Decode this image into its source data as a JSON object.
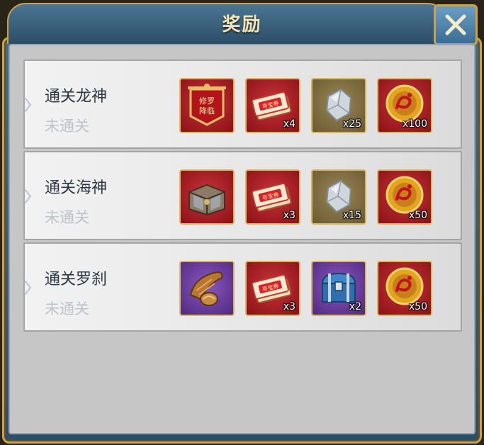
{
  "title": "奖励",
  "close": {
    "icon": "close-icon"
  },
  "rows": [
    {
      "title": "通关龙神",
      "status": "未通关",
      "rewards": [
        {
          "icon": "asura-banner-icon",
          "qty": "",
          "bg": "red"
        },
        {
          "icon": "treasure-ticket-icon",
          "qty": "x4",
          "bg": "red"
        },
        {
          "icon": "silver-ore-icon",
          "qty": "x25",
          "bg": "gold"
        },
        {
          "icon": "gold-coin-icon",
          "qty": "x100",
          "bg": "red"
        }
      ]
    },
    {
      "title": "通关海神",
      "status": "未通关",
      "rewards": [
        {
          "icon": "iron-chest-icon",
          "qty": "",
          "bg": "red"
        },
        {
          "icon": "treasure-ticket-icon",
          "qty": "x3",
          "bg": "red"
        },
        {
          "icon": "silver-ore-icon",
          "qty": "x15",
          "bg": "gold"
        },
        {
          "icon": "gold-coin-icon",
          "qty": "x50",
          "bg": "red"
        }
      ]
    },
    {
      "title": "通关罗刹",
      "status": "未通关",
      "rewards": [
        {
          "icon": "food-horn-icon",
          "qty": "",
          "bg": "purple"
        },
        {
          "icon": "treasure-ticket-icon",
          "qty": "x3",
          "bg": "red"
        },
        {
          "icon": "blue-chest-icon",
          "qty": "x2",
          "bg": "purple"
        },
        {
          "icon": "gold-coin-icon",
          "qty": "x50",
          "bg": "red"
        }
      ]
    }
  ],
  "ticket_text": "寻宝券",
  "banner_text": [
    "修罗",
    "降临"
  ],
  "colors": {
    "gold_border": "#c9a24a",
    "title_text": "#f4e5b3"
  }
}
